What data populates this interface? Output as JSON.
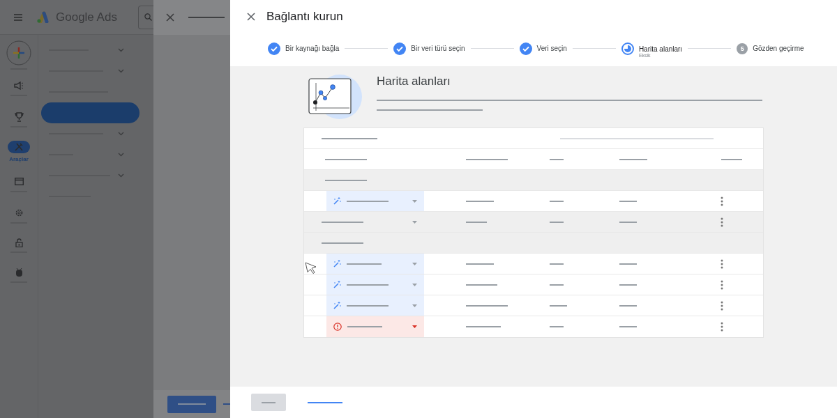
{
  "app": {
    "product": "Google Ads",
    "rail": [
      {
        "kind": "create"
      },
      {
        "kind": "megaphone",
        "selected": false
      },
      {
        "kind": "trophy",
        "selected": false
      },
      {
        "kind": "tools",
        "label": "Araçlar",
        "selected": true
      },
      {
        "kind": "card",
        "selected": false
      },
      {
        "kind": "gear",
        "selected": false
      },
      {
        "kind": "lock",
        "selected": false
      },
      {
        "kind": "bug",
        "selected": false
      }
    ],
    "nav": [
      {
        "expandable": true,
        "selected": false
      },
      {
        "expandable": true,
        "selected": false
      },
      {
        "expandable": false,
        "selected": false
      },
      {
        "expandable": false,
        "selected": true
      },
      {
        "expandable": true,
        "selected": false
      },
      {
        "expandable": true,
        "selected": false
      },
      {
        "expandable": true,
        "selected": false
      },
      {
        "expandable": false,
        "selected": false
      }
    ]
  },
  "dialog": {
    "title": "Bağlantı kurun",
    "steps": [
      {
        "label": "Bir kaynağı bağla",
        "done": true,
        "current": false
      },
      {
        "label": "Bir veri türü seçin",
        "done": true,
        "current": false
      },
      {
        "label": "Veri seçin",
        "done": true,
        "current": false
      },
      {
        "label": "Harita alanları",
        "done": false,
        "current": true,
        "note": "Eksik"
      },
      {
        "label": "Gözden geçirme",
        "done": false,
        "current": false,
        "number": "5"
      }
    ],
    "section_title": "Harita alanları",
    "rows": [
      {
        "kind": "header"
      },
      {
        "kind": "columns"
      },
      {
        "kind": "group"
      },
      {
        "kind": "field",
        "auto_mapped": true,
        "error": false
      },
      {
        "kind": "plain",
        "auto_mapped": false,
        "error": false
      },
      {
        "kind": "group"
      },
      {
        "kind": "field",
        "auto_mapped": true,
        "error": false
      },
      {
        "kind": "field",
        "auto_mapped": true,
        "error": false
      },
      {
        "kind": "field",
        "auto_mapped": true,
        "error": false
      },
      {
        "kind": "field",
        "auto_mapped": false,
        "error": true
      }
    ]
  }
}
